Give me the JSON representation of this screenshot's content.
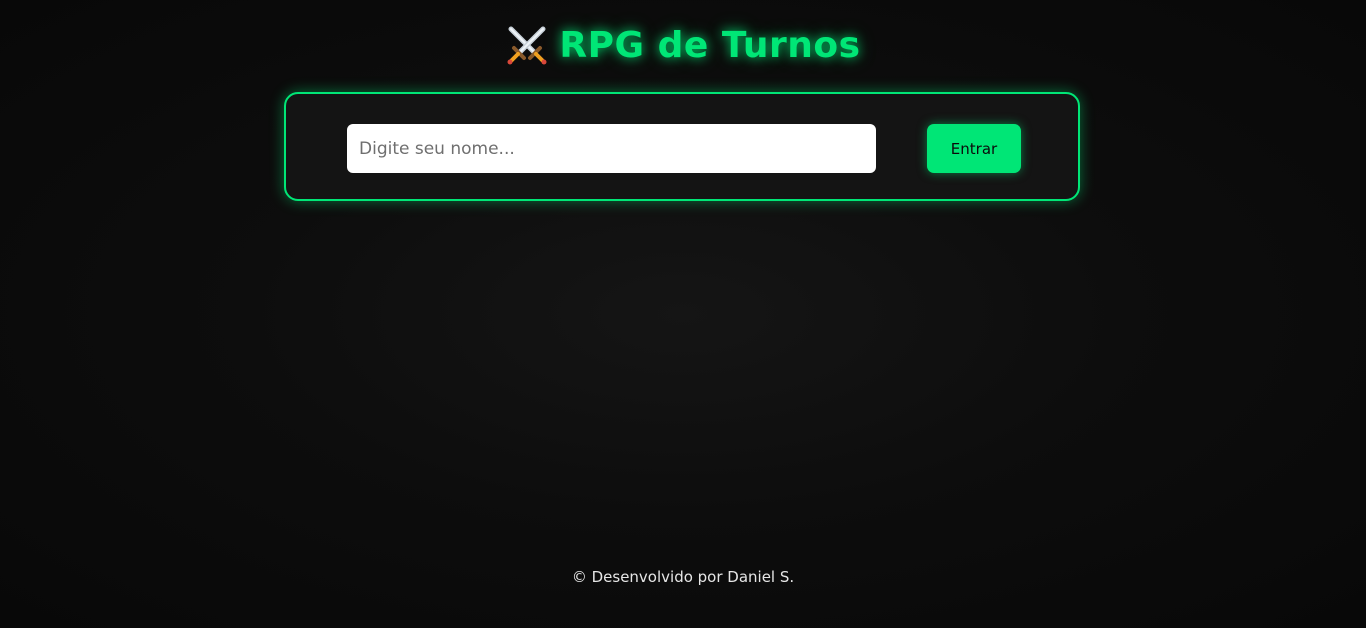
{
  "header": {
    "icon": "crossed-swords-icon",
    "title": "RPG de Turnos"
  },
  "login": {
    "name_placeholder": "Digite seu nome...",
    "name_value": "",
    "enter_label": "Entrar"
  },
  "footer": {
    "text": "© Desenvolvido por Daniel S."
  },
  "colors": {
    "accent": "#00e676",
    "background": "#0a0a0a",
    "panel": "#141414"
  }
}
